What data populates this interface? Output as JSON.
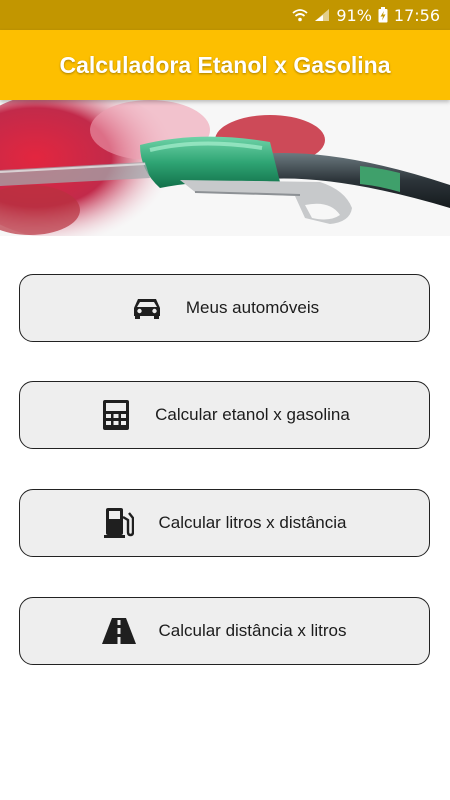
{
  "status_bar": {
    "battery": "91%",
    "time": "17:56",
    "icons": [
      "wifi-icon",
      "signal-icon",
      "battery-charging-icon"
    ]
  },
  "app_bar": {
    "title": "Calculadora Etanol x Gasolina"
  },
  "banner": {
    "image": "fuel-pump-nozzle-image"
  },
  "menu": {
    "items": [
      {
        "label": "Meus automóveis",
        "icon": "car-icon"
      },
      {
        "label": "Calcular etanol x gasolina",
        "icon": "calculator-icon"
      },
      {
        "label": "Calcular litros x distância",
        "icon": "fuel-pump-icon"
      },
      {
        "label": "Calcular distância x litros",
        "icon": "road-icon"
      }
    ]
  },
  "colors": {
    "app_bar": "#fdbf00",
    "status_bar": "#c29600",
    "button_bg": "#eeeeee",
    "button_border": "#222222"
  }
}
